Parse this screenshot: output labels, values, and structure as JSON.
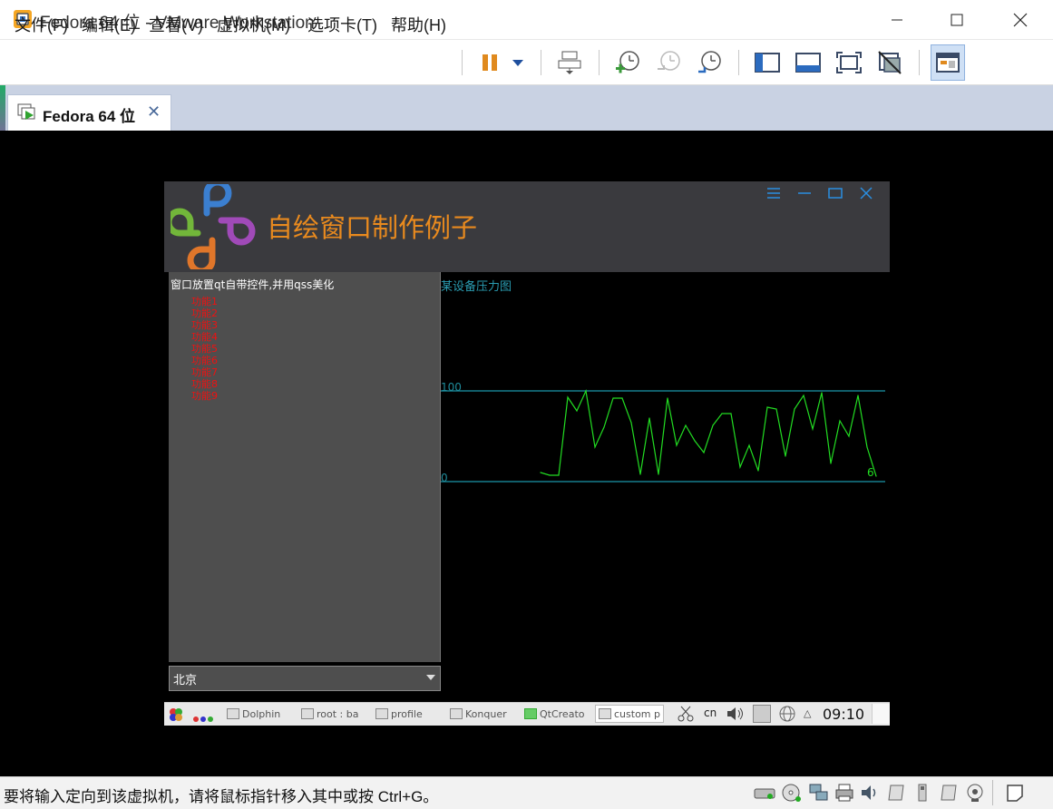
{
  "window": {
    "title": "Fedora 64 位 - VMware Workstation",
    "icon": "vmware-icon"
  },
  "menu": {
    "items": [
      "文件(F)",
      "编辑(E)",
      "查看(V)",
      "虚拟机(M)",
      "选项卡(T)",
      "帮助(H)"
    ]
  },
  "toolbar": {
    "icons": [
      "pause-icon",
      "dropdown-icon",
      "send-ctrl-alt-del-icon",
      "snapshot-take-icon",
      "snapshot-revert-icon",
      "snapshot-manager-icon",
      "show-library-icon",
      "thumbnail-bar-icon",
      "fullscreen-icon",
      "unity-icon",
      "console-view-icon"
    ]
  },
  "tab": {
    "label": "Fedora 64 位",
    "close": "✕"
  },
  "app": {
    "title": "自绘窗口制作例子",
    "tree_title": "窗口放置qt自带控件,并用qss美化",
    "tree_items": [
      "功能1",
      "功能2",
      "功能3",
      "功能4",
      "功能5",
      "功能6",
      "功能7",
      "功能8",
      "功能9"
    ],
    "combo_value": "北京"
  },
  "chart_data": {
    "type": "line",
    "title": "某设备压力图",
    "ylim": [
      0,
      100
    ],
    "y_ticks": [
      "100",
      "0"
    ],
    "last_value_label": "6",
    "grid": "horizontal lines at 0 and 100",
    "series": [
      {
        "color": "#22dd22",
        "values": [
          10,
          7,
          7,
          93,
          78,
          100,
          38,
          60,
          92,
          92,
          65,
          8,
          70,
          8,
          92,
          40,
          62,
          45,
          32,
          62,
          75,
          75,
          16,
          40,
          12,
          82,
          80,
          28,
          80,
          95,
          58,
          98,
          20,
          67,
          50,
          95,
          38,
          6
        ]
      }
    ]
  },
  "taskbar": {
    "items": [
      "Dolphin",
      "root : ba",
      "profile",
      "Konquer",
      "QtCreato",
      "custom p"
    ],
    "tray": [
      "cn"
    ],
    "clock": "09:10"
  },
  "status": {
    "text": "要将输入定向到该虚拟机，请将鼠标指针移入其中或按 Ctrl+G。",
    "icons": [
      "hdd-icon",
      "cdrom-icon",
      "network-icon",
      "printer-icon",
      "sound-icon",
      "floppy-icon",
      "usb-icon",
      "removable-icon",
      "camera-icon",
      "message-icon"
    ]
  }
}
